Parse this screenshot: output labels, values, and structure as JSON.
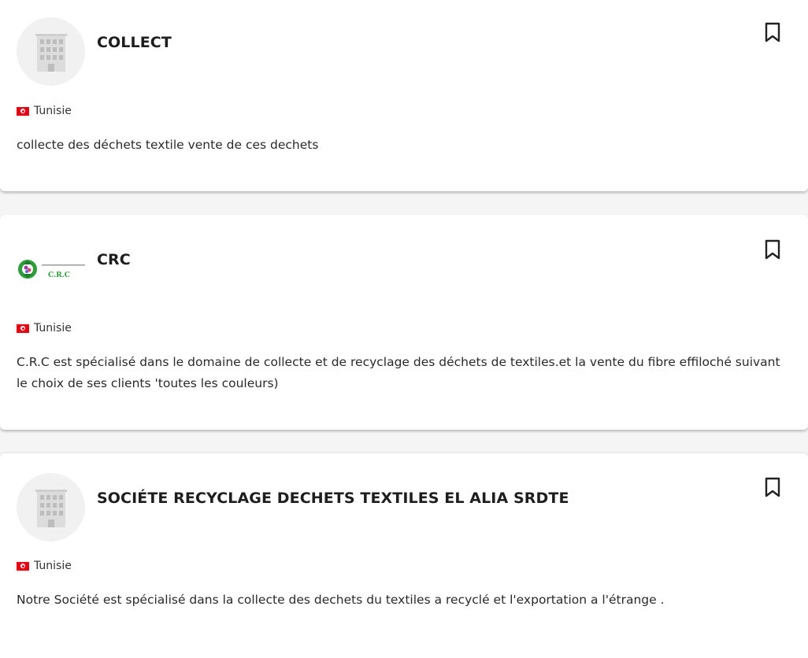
{
  "companies": [
    {
      "name": "COLLECT",
      "logo_icon": "building-placeholder-icon",
      "country": "Tunisie",
      "description": "collecte des déchets textile vente de ces dechets",
      "bookmark_icon": "bookmark-icon"
    },
    {
      "name": "CRC",
      "logo_icon": "recycle-logo-icon",
      "logo_text": "C.R.C",
      "country": "Tunisie",
      "description": "C.R.C est spécialisé dans le domaine de collecte et de recyclage des déchets de textiles.et la vente du fibre effiloché suivant le choix de ses clients 'toutes les couleurs)",
      "bookmark_icon": "bookmark-icon"
    },
    {
      "name": "SOCIÉTE RECYCLAGE DECHETS TEXTILES EL ALIA SRDTE",
      "logo_icon": "building-placeholder-icon",
      "country": "Tunisie",
      "description": "Notre Société est spécialisé dans la collecte des dechets du textiles a recyclé et l'exportation a l'étrange .",
      "bookmark_icon": "bookmark-icon"
    }
  ],
  "colors": {
    "page_background": "#f5f5f5",
    "card_background": "#ffffff",
    "flag_red": "#e70013",
    "recycle_green": "#2e9e3a"
  }
}
